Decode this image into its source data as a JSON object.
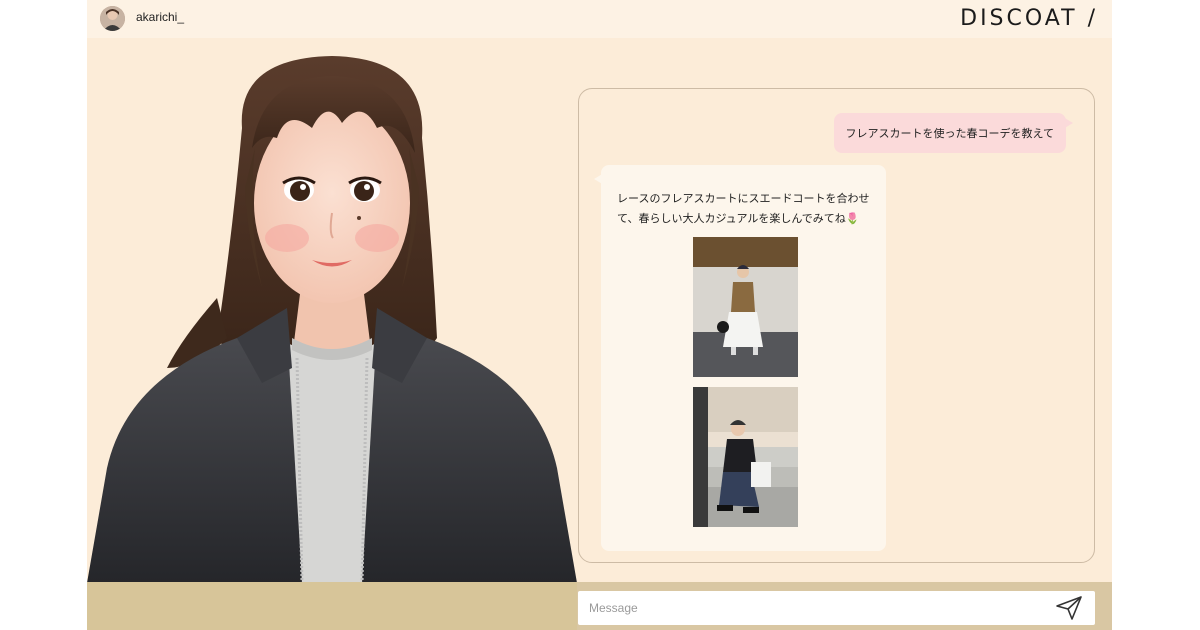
{
  "header": {
    "username": "akarichi_",
    "logo": "DISCOAT /"
  },
  "chat": {
    "messages": [
      {
        "role": "user",
        "text": "フレアスカートを使った春コーデを教えて"
      },
      {
        "role": "bot",
        "text": "レースのフレアスカートにスエードコートを合わせて、春らしい大人カジュアルを楽しんでみてね🌷"
      }
    ]
  },
  "composer": {
    "placeholder": "Message",
    "send_icon": "send-icon"
  },
  "colors": {
    "background": "#fcecd8",
    "user_bubble": "#fbdada",
    "bot_bubble": "#fdf6ec",
    "bottom_bar": "#d9c7a3"
  }
}
